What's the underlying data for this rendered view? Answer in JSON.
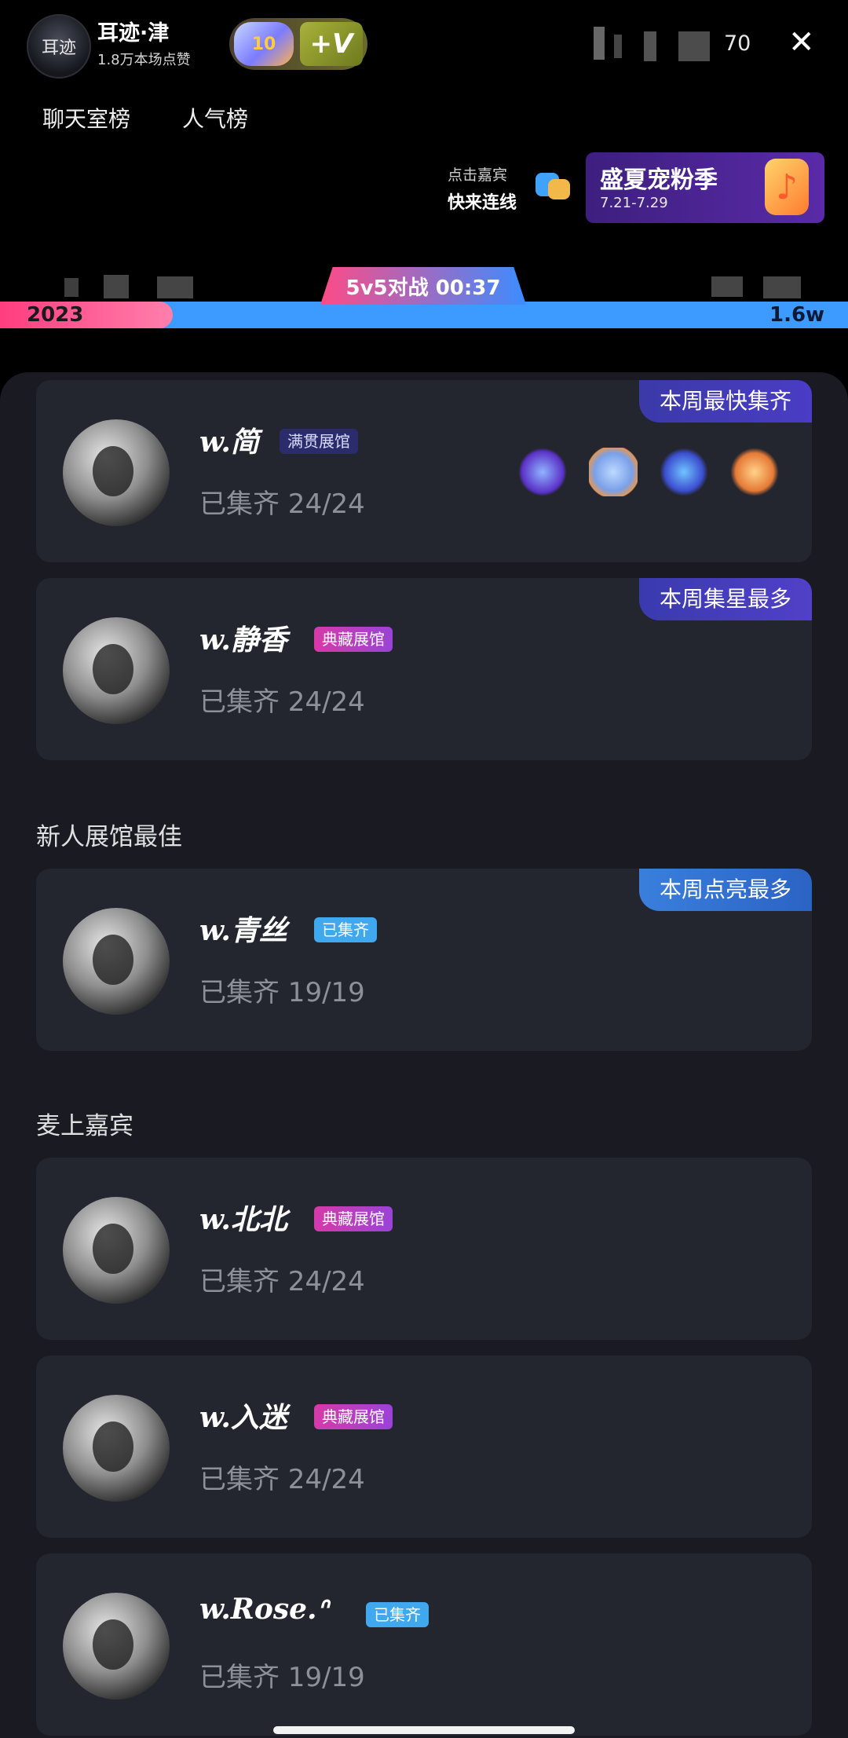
{
  "header": {
    "logo_text": "耳迹",
    "room_title": "耳迹·津",
    "room_subtitle": "1.8万本场点赞",
    "badge_heart_level": "10",
    "badge_v": "+V",
    "viewer_count": "70",
    "close_icon": "✕"
  },
  "rank_tabs": [
    "聊天室榜",
    "人气榜"
  ],
  "guest_link": {
    "line1": "点击嘉宾",
    "line2": "快来连线"
  },
  "promo": {
    "title": "盛夏宠粉季",
    "date": "7.21-7.29"
  },
  "pk": {
    "label": "5v5对战 00:37",
    "left_value": "2023",
    "right_value": "1.6w"
  },
  "sections": {
    "new_best": "新人展馆最佳",
    "on_mic": "麦上嘉宾"
  },
  "cards": [
    {
      "name": "w.简",
      "tag": "满贯展馆",
      "tag_style": "blue",
      "progress": "已集齐 24/24",
      "week_badge": "本周最快集齐",
      "gifts": [
        "rocket-gift-icon",
        "balloon-gift-icon",
        "jet-gift-icon",
        "mascot-gift-icon"
      ]
    },
    {
      "name": "w.静香",
      "tag": "典藏展馆",
      "tag_style": "pink",
      "progress": "已集齐 24/24",
      "week_badge": "本周集星最多"
    },
    {
      "name": "w.青丝",
      "tag": "已集齐",
      "tag_style": "cyan",
      "progress": "已集齐 19/19",
      "week_badge": "本周点亮最多"
    },
    {
      "name": "w.北北",
      "tag": "典藏展馆",
      "tag_style": "pink",
      "progress": "已集齐 24/24"
    },
    {
      "name": "w.入迷",
      "tag": "典藏展馆",
      "tag_style": "pink",
      "progress": "已集齐 24/24"
    },
    {
      "name": "w.Rose.⁠ᐢ",
      "tag": "已集齐",
      "tag_style": "cyan",
      "progress": "已集齐 19/19"
    }
  ]
}
